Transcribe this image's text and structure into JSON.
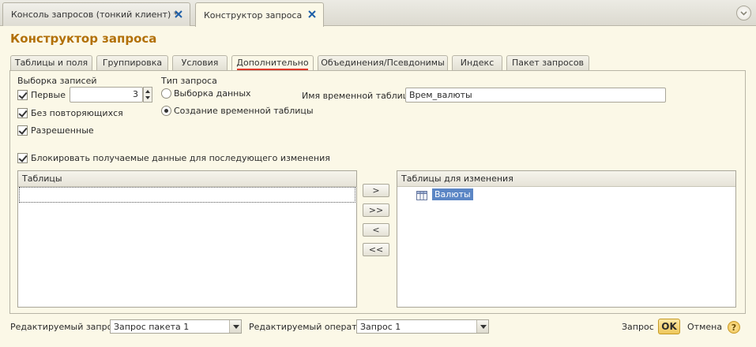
{
  "window_tabs": [
    {
      "label": "Консоль запросов (тонкий клиент) *"
    },
    {
      "label": "Конструктор запроса"
    }
  ],
  "form_title": "Конструктор запроса",
  "tabs": [
    {
      "label": "Таблицы и поля"
    },
    {
      "label": "Группировка"
    },
    {
      "label": "Условия"
    },
    {
      "label": "Дополнительно"
    },
    {
      "label": "Объединения/Псевдонимы"
    },
    {
      "label": "Индекс"
    },
    {
      "label": "Пакет запросов"
    }
  ],
  "selection": {
    "title": "Выборка записей",
    "first_label": "Первые",
    "first_checked": true,
    "first_value": "3",
    "distinct_label": "Без повторяющихся",
    "distinct_checked": true,
    "allowed_label": "Разрешенные",
    "allowed_checked": true
  },
  "query_type": {
    "title": "Тип запроса",
    "option_select": "Выборка данных",
    "option_temp": "Создание временной таблицы",
    "selected": "option_temp"
  },
  "temp_table": {
    "label": "Имя временной таблицы:",
    "value": "Врем_валюты"
  },
  "lock": {
    "label": "Блокировать получаемые данные для последующего изменения",
    "checked": true
  },
  "tables_list": {
    "header": "Таблицы"
  },
  "change_tables": {
    "header": "Таблицы для изменения",
    "items": [
      "Валюты"
    ]
  },
  "move_buttons": [
    ">",
    ">>",
    "<",
    "<<"
  ],
  "footer": {
    "edit_query_label": "Редактируемый запрос:",
    "edit_query_value": "Запрос пакета 1",
    "edit_operator_label": "Редактируемый оператор:",
    "edit_operator_value": "Запрос 1",
    "query_link": "Запрос",
    "ok": "OK",
    "cancel": "Отмена",
    "help": "?"
  },
  "colors": {
    "title": "#b27008",
    "selection": "#5b86c5",
    "active_tab_underline": "#e03a2b"
  }
}
